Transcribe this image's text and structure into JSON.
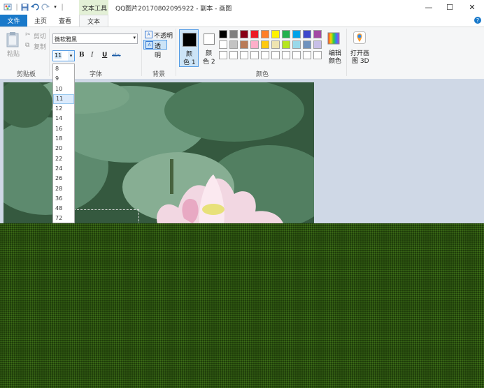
{
  "titlebar": {
    "tool_tab_label": "文本工具",
    "title": "QQ图片20170802095922 - 副本 - 画图",
    "qa_divider": "|"
  },
  "tabs": {
    "file": "文件",
    "home": "主页",
    "view": "查看",
    "text": "文本",
    "help": "?"
  },
  "clipboard": {
    "paste": "粘贴",
    "cut": "剪切",
    "copy": "复制",
    "group": "剪贴板"
  },
  "font": {
    "family": "微软雅黑",
    "size": "11",
    "bold": "B",
    "italic": "I",
    "underline": "U",
    "strike": "abc",
    "group": "字体"
  },
  "background": {
    "opaque": "不透明",
    "transparent": "透明",
    "group": "背景"
  },
  "colors": {
    "color1_label_top": "颜",
    "color1_label_bottom": "色 1",
    "color2_label_top": "颜",
    "color2_label_bottom": "色 2",
    "color1": "#000000",
    "color2": "#ffffff",
    "edit_top": "编辑",
    "edit_bottom": "颜色",
    "group": "颜色",
    "palette_row1": [
      "#000000",
      "#7f7f7f",
      "#880015",
      "#ed1c24",
      "#ff7f27",
      "#fff200",
      "#22b14c",
      "#00a2e8",
      "#3f48cc",
      "#a349a4"
    ],
    "palette_row2": [
      "#ffffff",
      "#c3c3c3",
      "#b97a57",
      "#ffaec9",
      "#ffc90e",
      "#efe4b0",
      "#b5e61d",
      "#99d9ea",
      "#7092be",
      "#c8bfe7"
    ]
  },
  "paint3d": {
    "line1": "打开画",
    "line2": "图 3D"
  },
  "size_options": [
    "8",
    "9",
    "10",
    "11",
    "12",
    "14",
    "16",
    "18",
    "20",
    "22",
    "24",
    "26",
    "28",
    "36",
    "48",
    "72"
  ],
  "selected_size": "11"
}
